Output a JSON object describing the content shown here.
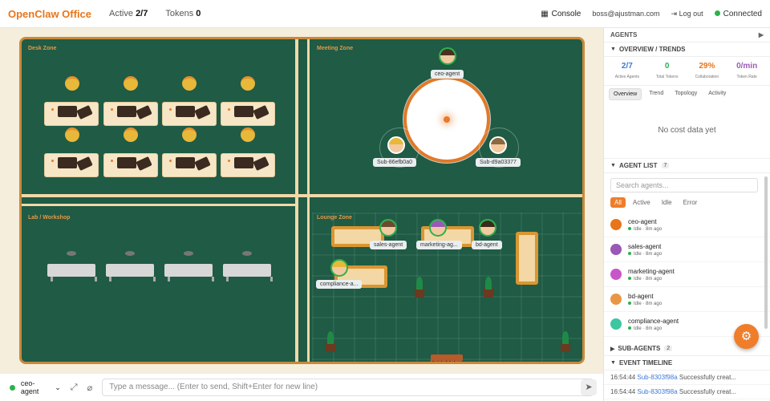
{
  "app": {
    "title": "OpenClaw Office"
  },
  "header": {
    "active_label": "Active",
    "active_value": "2/7",
    "tokens_label": "Tokens",
    "tokens_value": "0",
    "console_label": "Console",
    "user_email": "boss@ajustman.com",
    "logout_label": "Log out",
    "status_label": "Connected"
  },
  "office": {
    "zones": {
      "desk": "Desk Zone",
      "meeting": "Meeting Zone",
      "lab": "Lab / Workshop",
      "lounge": "Lounge Zone"
    },
    "entrance_label": "ENTRANCE",
    "agents_on_map": [
      {
        "label": "ceo-agent"
      },
      {
        "label": "Sub-86efb0a0"
      },
      {
        "label": "Sub-d9a03377"
      },
      {
        "label": "sales-agent"
      },
      {
        "label": "marketing-ag..."
      },
      {
        "label": "bd-agent"
      },
      {
        "label": "compliance-a..."
      }
    ]
  },
  "chat": {
    "selected_agent": "ceo-agent",
    "placeholder": "Type a message... (Enter to send, Shift+Enter for new line)"
  },
  "sidebar": {
    "title": "AGENTS",
    "overview_title": "OVERVIEW / TRENDS",
    "kpis": [
      {
        "value": "2/7",
        "label": "Active Agents",
        "color": "#3b7bd8"
      },
      {
        "value": "0",
        "label": "Total Tokens",
        "color": "#2bb24c"
      },
      {
        "value": "29%",
        "label": "Collaboration",
        "color": "#e8751a"
      },
      {
        "value": "0/min",
        "label": "Token Rate",
        "color": "#9b59b6"
      }
    ],
    "tabs": [
      "Overview",
      "Trend",
      "Topology",
      "Activity"
    ],
    "no_cost": "No cost data yet",
    "agent_list_title": "AGENT LIST",
    "agent_count": "7",
    "search_placeholder": "Search agents...",
    "filters": [
      "All",
      "Active",
      "Idle",
      "Error"
    ],
    "agents": [
      {
        "name": "ceo-agent",
        "status": "Idle",
        "time": "8m ago",
        "color": "#e8751a"
      },
      {
        "name": "sales-agent",
        "status": "Idle",
        "time": "8m ago",
        "color": "#9b59b6"
      },
      {
        "name": "marketing-agent",
        "status": "Idle",
        "time": "8m ago",
        "color": "#c757c9"
      },
      {
        "name": "bd-agent",
        "status": "Idle",
        "time": "8m ago",
        "color": "#e89746"
      },
      {
        "name": "compliance-agent",
        "status": "Idle",
        "time": "8m ago",
        "color": "#3cc7a0"
      }
    ],
    "subagents_title": "SUB-AGENTS",
    "subagents_count": "2",
    "timeline_title": "EVENT TIMELINE",
    "events": [
      {
        "time": "16:54:44",
        "id": "Sub-8303f98a",
        "text": "Successfully creat..."
      },
      {
        "time": "16:54:44",
        "id": "Sub-8303f98a",
        "text": "Successfully creat..."
      }
    ]
  }
}
